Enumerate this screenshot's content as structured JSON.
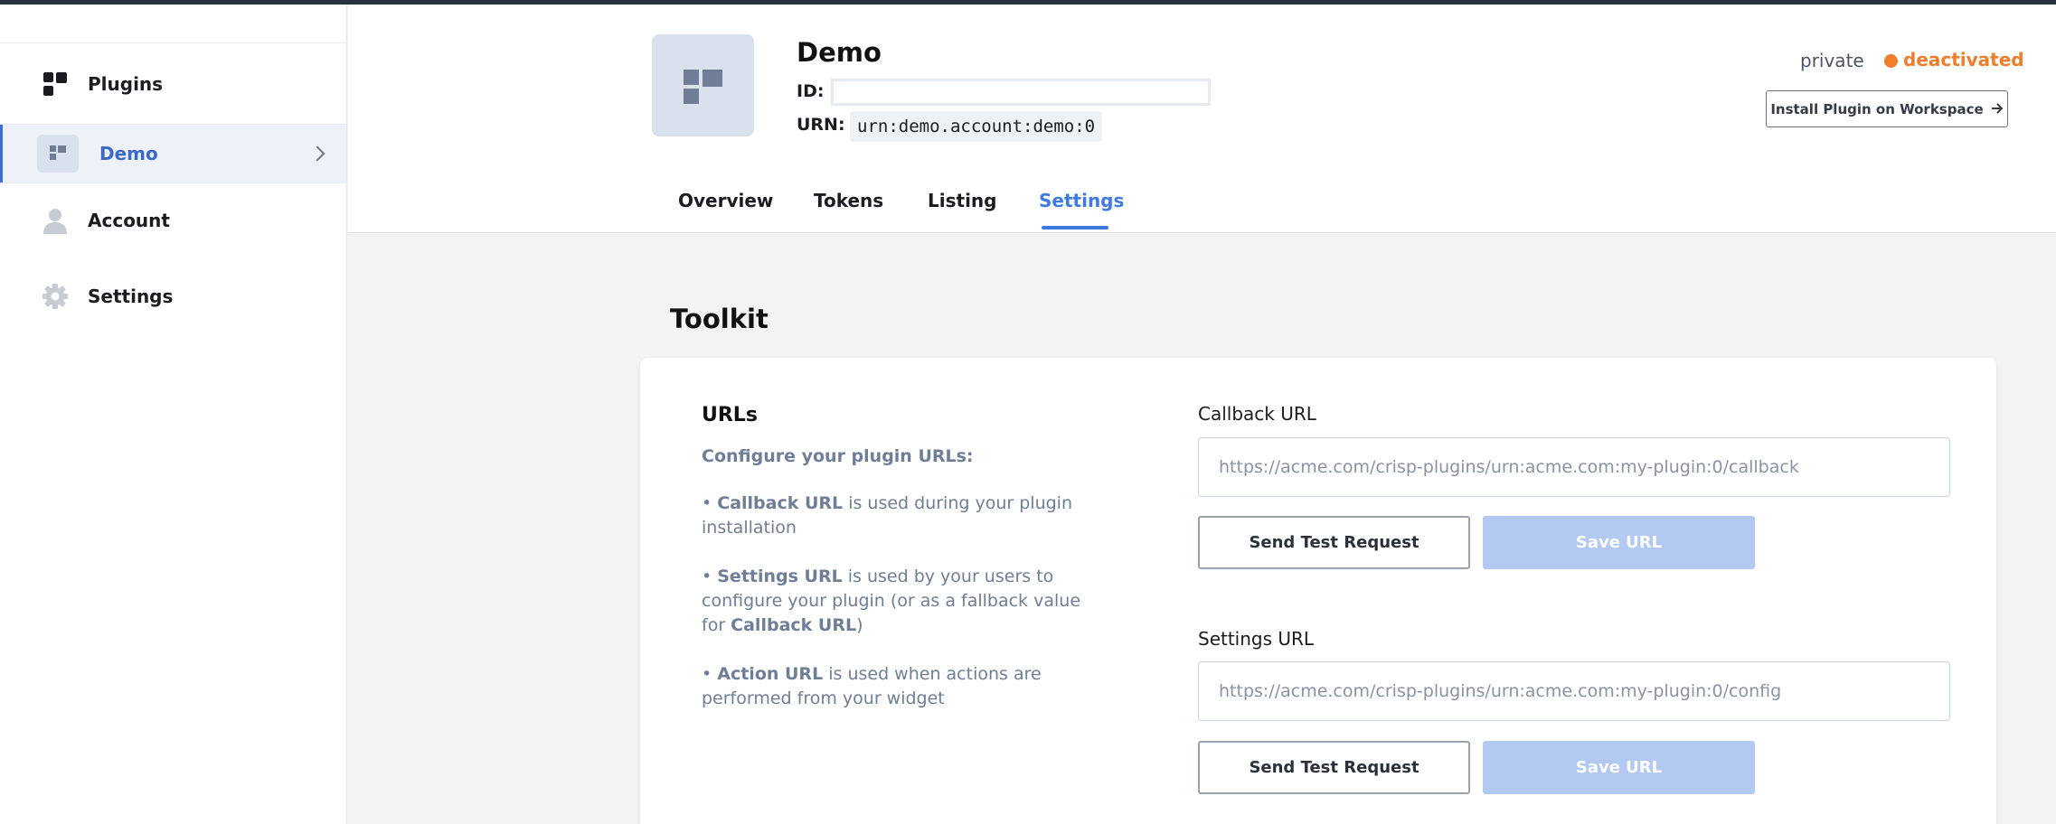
{
  "sidebar": {
    "items": [
      {
        "label": "Plugins",
        "icon": "plugins-grid-icon"
      },
      {
        "label": "Demo",
        "icon": "plugin-thumbnail-icon",
        "active": true
      },
      {
        "label": "Account",
        "icon": "user-icon"
      },
      {
        "label": "Settings",
        "icon": "gear-icon"
      }
    ]
  },
  "header": {
    "plugin_name": "Demo",
    "id_label": "ID:",
    "id_value": "",
    "urn_label": "URN:",
    "urn_value": "urn:demo.account:demo:0",
    "visibility": "private",
    "status": "deactivated",
    "status_color": "#ee7d2c",
    "install_button": "Install Plugin on Workspace",
    "tabs": [
      {
        "label": "Overview"
      },
      {
        "label": "Tokens"
      },
      {
        "label": "Listing"
      },
      {
        "label": "Settings",
        "active": true
      }
    ]
  },
  "main": {
    "section_title": "Toolkit",
    "urls": {
      "title": "URLs",
      "subtitle": "Configure your plugin URLs:",
      "bullets": [
        {
          "term": "Callback URL",
          "text": " is used during your plugin installation"
        },
        {
          "term": "Settings URL",
          "text": " is used by your users to configure your plugin (or as a fallback value for ",
          "term2": "Callback URL",
          "text2": ")"
        },
        {
          "term": "Action URL",
          "text": " is used when actions are performed from your widget"
        }
      ]
    },
    "callback": {
      "label": "Callback URL",
      "placeholder": "https://acme.com/crisp-plugins/urn:acme.com:my-plugin:0/callback",
      "test_button": "Send Test Request",
      "save_button": "Save URL"
    },
    "settings_url": {
      "label": "Settings URL",
      "placeholder": "https://acme.com/crisp-plugins/urn:acme.com:my-plugin:0/config",
      "test_button": "Send Test Request",
      "save_button": "Save URL"
    }
  },
  "colors": {
    "accent": "#3f7ae0",
    "save_disabled": "#b3c9f1"
  }
}
